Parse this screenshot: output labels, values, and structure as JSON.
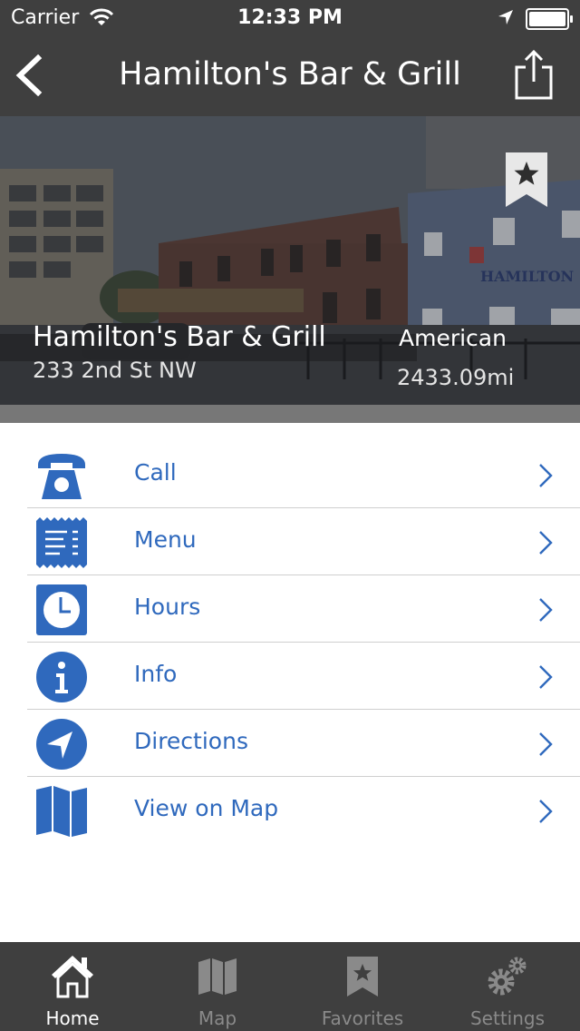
{
  "status_bar": {
    "carrier": "Carrier",
    "time": "12:33 PM"
  },
  "nav": {
    "title": "Hamilton's Bar & Grill",
    "back_icon": "chevron-left-icon",
    "share_icon": "share-icon"
  },
  "hero": {
    "name": "Hamilton's Bar & Grill",
    "address": "233 2nd St NW",
    "cuisine": "American",
    "distance": "2433.09mi",
    "bookmark_icon": "bookmark-star-icon",
    "sign_text": "HAMILTON"
  },
  "actions": [
    {
      "label": "Call",
      "icon": "phone-icon"
    },
    {
      "label": "Menu",
      "icon": "menu-receipt-icon"
    },
    {
      "label": "Hours",
      "icon": "clock-icon"
    },
    {
      "label": "Info",
      "icon": "info-icon"
    },
    {
      "label": "Directions",
      "icon": "navigation-arrow-icon"
    },
    {
      "label": "View on Map",
      "icon": "map-icon"
    }
  ],
  "tabs": [
    {
      "label": "Home",
      "icon": "home-icon",
      "active": true
    },
    {
      "label": "Map",
      "icon": "map-icon",
      "active": false
    },
    {
      "label": "Favorites",
      "icon": "bookmark-star-icon",
      "active": false
    },
    {
      "label": "Settings",
      "icon": "gear-icon",
      "active": false
    }
  ],
  "colors": {
    "accent": "#2f69bd",
    "bar": "#3f3f3f",
    "separator": "#cfcfcf"
  }
}
